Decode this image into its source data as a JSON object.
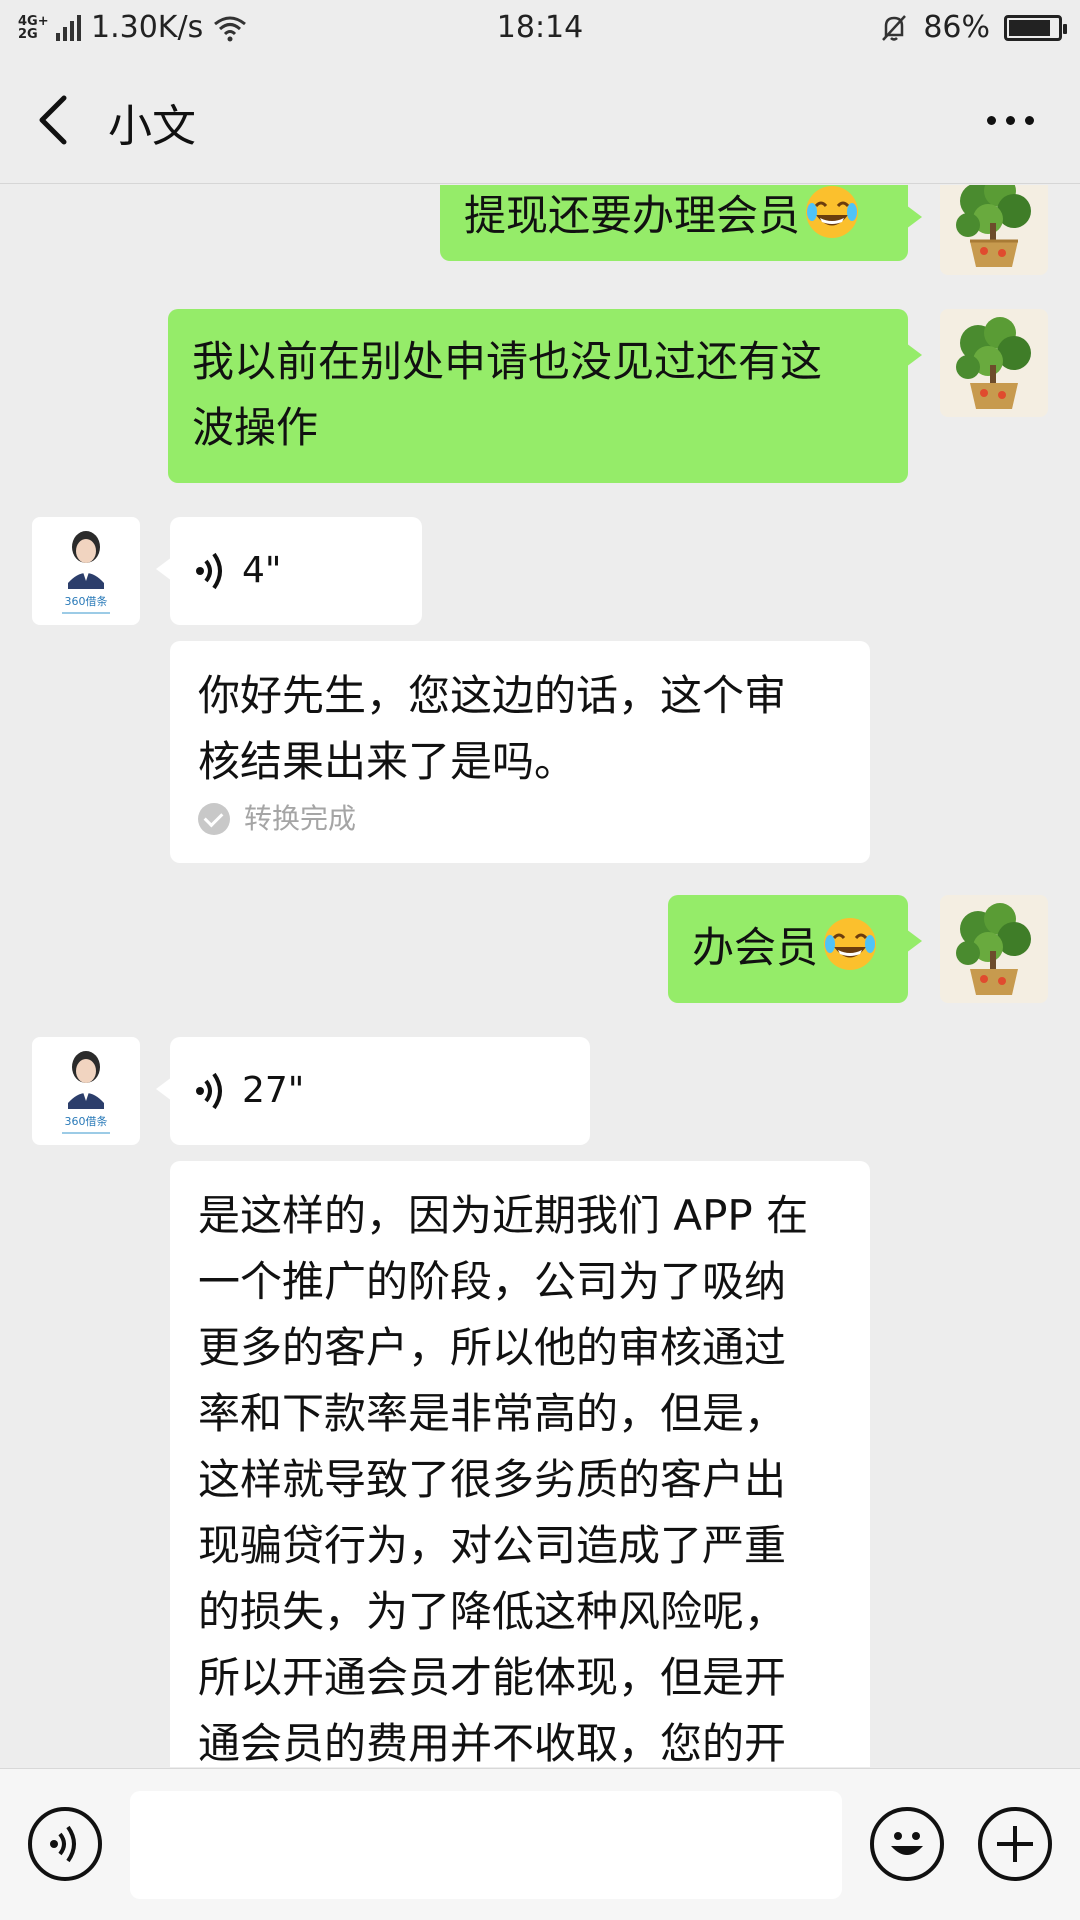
{
  "status_bar": {
    "network_type_top": "4G+",
    "network_type_bottom": "2G",
    "speed": "1.30K/s",
    "time": "18:14",
    "battery": "86%",
    "battery_level": 0.86
  },
  "header": {
    "title": "小文"
  },
  "messages": [
    {
      "side": "me",
      "text": "提现还要办理会员",
      "emoji": "tears-of-joy"
    },
    {
      "side": "me",
      "line1": "我以前在别处申请也没见过还有这",
      "line2": "波操作"
    },
    {
      "side": "other",
      "type": "voice",
      "duration": "4\""
    },
    {
      "side": "other",
      "type": "transcript",
      "line1": "你好先生，您这边的话，这个审",
      "line2": "核结果出来了是吗。",
      "status": "转换完成"
    },
    {
      "side": "me",
      "text": "办会员",
      "emoji": "tears-of-joy"
    },
    {
      "side": "other",
      "type": "voice",
      "duration": "27\""
    },
    {
      "side": "other",
      "type": "transcript",
      "lines": [
        "是这样的，因为近期我们 APP 在",
        "一个推广的阶段，公司为了吸纳",
        "更多的客户，所以他的审核通过",
        "率和下款率是非常高的，但是，",
        "这样就导致了很多劣质的客户出",
        "现骗贷行为，对公司造成了严重",
        "的损失，为了降低这种风险呢，",
        "所以开通会员才能体现，但是开",
        "通会员的费用并不收取，您的开"
      ]
    }
  ],
  "avatars": {
    "me": "potted-plant-avatar",
    "other": "woman-portrait-avatar",
    "other_logo": "360借条"
  },
  "colors": {
    "background": "#ededed",
    "my_bubble": "#95ec69",
    "other_bubble": "#ffffff",
    "muted_text": "#a5a5a5"
  }
}
